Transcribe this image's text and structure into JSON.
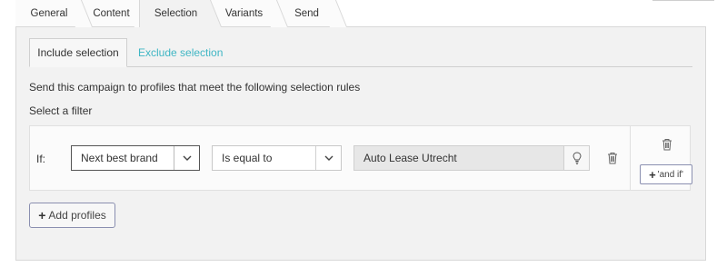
{
  "tabs": [
    {
      "label": "General"
    },
    {
      "label": "Content"
    },
    {
      "label": "Selection"
    },
    {
      "label": "Variants"
    },
    {
      "label": "Send"
    }
  ],
  "active_tab": "Selection",
  "selection": {
    "sub_tabs": [
      {
        "label": "Include selection"
      },
      {
        "label": "Exclude selection"
      }
    ],
    "description": "Send this campaign to profiles that meet the following selection rules",
    "filter_label": "Select a filter",
    "rule": {
      "if_label": "If:",
      "field": "Next best brand",
      "operator": "Is equal to",
      "value": "Auto Lease Utrecht"
    },
    "and_if_label": "'and if'",
    "add_profiles_label": "Add profiles"
  },
  "icons": {
    "caret": "chevron-down-icon",
    "suggest": "lightbulb-icon",
    "delete": "trash-icon",
    "add": "plus-icon"
  },
  "colors": {
    "link": "#3fb6c4",
    "panel": "#f2f2f2",
    "button_border": "#8a8fb0"
  }
}
